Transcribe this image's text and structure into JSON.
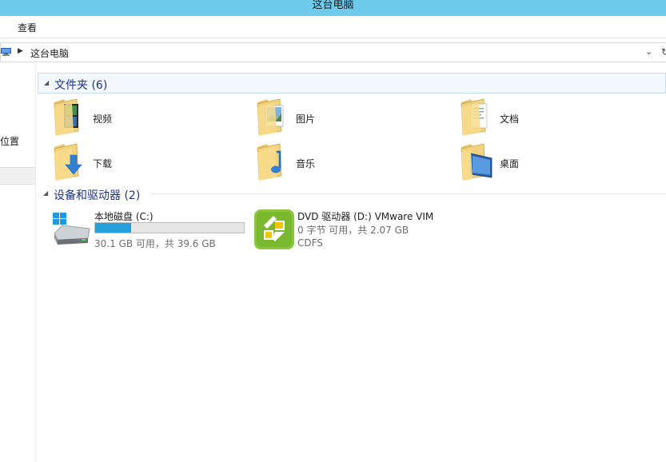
{
  "window": {
    "title": "这台电脑"
  },
  "menu": {
    "view_label": "查看"
  },
  "address": {
    "path": "这台电脑",
    "dropdown_glyph": "⌄",
    "refresh_glyph": "↻"
  },
  "nav": {
    "partial_label": "位置"
  },
  "groups": {
    "folders": {
      "title": "文件夹 (6)",
      "items": [
        {
          "label": "视频",
          "icon": "videos-folder-icon"
        },
        {
          "label": "图片",
          "icon": "pictures-folder-icon"
        },
        {
          "label": "文档",
          "icon": "documents-folder-icon"
        },
        {
          "label": "下载",
          "icon": "downloads-folder-icon"
        },
        {
          "label": "音乐",
          "icon": "music-folder-icon"
        },
        {
          "label": "桌面",
          "icon": "desktop-folder-icon"
        }
      ]
    },
    "devices": {
      "title": "设备和驱动器 (2)",
      "items": [
        {
          "name": "本地磁盘 (C:)",
          "space": "30.1 GB 可用，共 39.6 GB",
          "used_fraction": 0.24,
          "icon": "hard-disk-icon"
        },
        {
          "name": "DVD 驱动器 (D:) VMware VIM",
          "space": "0 字节 可用，共 2.07 GB",
          "filesystem": "CDFS",
          "icon": "vmware-dvd-icon"
        }
      ]
    }
  },
  "colors": {
    "titlebar": "#6fcbec",
    "group_title": "#1e3287",
    "drive_bar": "#26a0da"
  }
}
